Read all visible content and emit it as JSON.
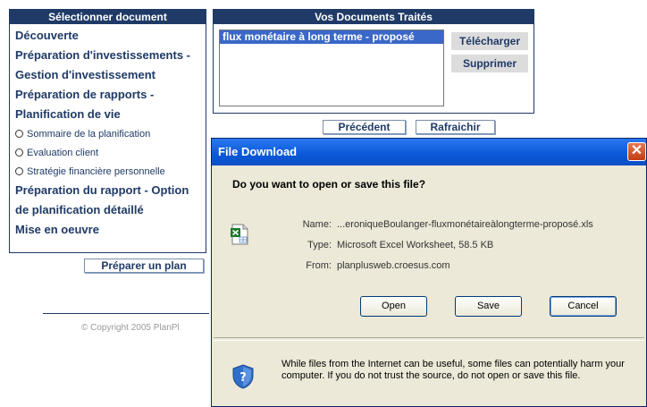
{
  "left_panel": {
    "header": "Sélectionner document",
    "items": [
      {
        "label": "Découverte"
      },
      {
        "label": "Préparation d'investissements -"
      },
      {
        "label": "Gestion d'investissement"
      },
      {
        "label": "Préparation de rapports -"
      },
      {
        "label": "Planification de vie"
      }
    ],
    "radios": [
      {
        "label": "Sommaire de la planification"
      },
      {
        "label": "Evaluation client"
      },
      {
        "label": "Stratégie financière personnelle"
      }
    ],
    "items_after": [
      {
        "label": "Préparation du rapport - Option"
      },
      {
        "label": "de planification détaillé"
      },
      {
        "label": "Mise en oeuvre"
      }
    ]
  },
  "prepare_button": "Préparer un plan",
  "right_panel": {
    "header": "Vos Documents Traités",
    "documents": [
      "flux monétaire à long terme - proposé"
    ],
    "download_button": "Télécharger",
    "delete_button": "Supprimer"
  },
  "nav_buttons": {
    "previous": "Précédent",
    "refresh": "Rafraichir"
  },
  "copyright": "© Copyright 2005 PlanPl",
  "dialog": {
    "title": "File Download",
    "close_symbol": "✕",
    "question": "Do you want to open or save this file?",
    "name_label": "Name:",
    "name_value": "...eroniqueBoulanger-fluxmonétaireàlongterme-proposé.xls",
    "type_label": "Type:",
    "type_value": "Microsoft Excel Worksheet, 58.5 KB",
    "from_label": "From:",
    "from_value": "planplusweb.croesus.com",
    "open_button": "Open",
    "save_button": "Save",
    "cancel_button": "Cancel",
    "warning": "While files from the Internet can be useful, some files can potentially harm your computer. If you do not trust the source, do not open or save this file."
  }
}
